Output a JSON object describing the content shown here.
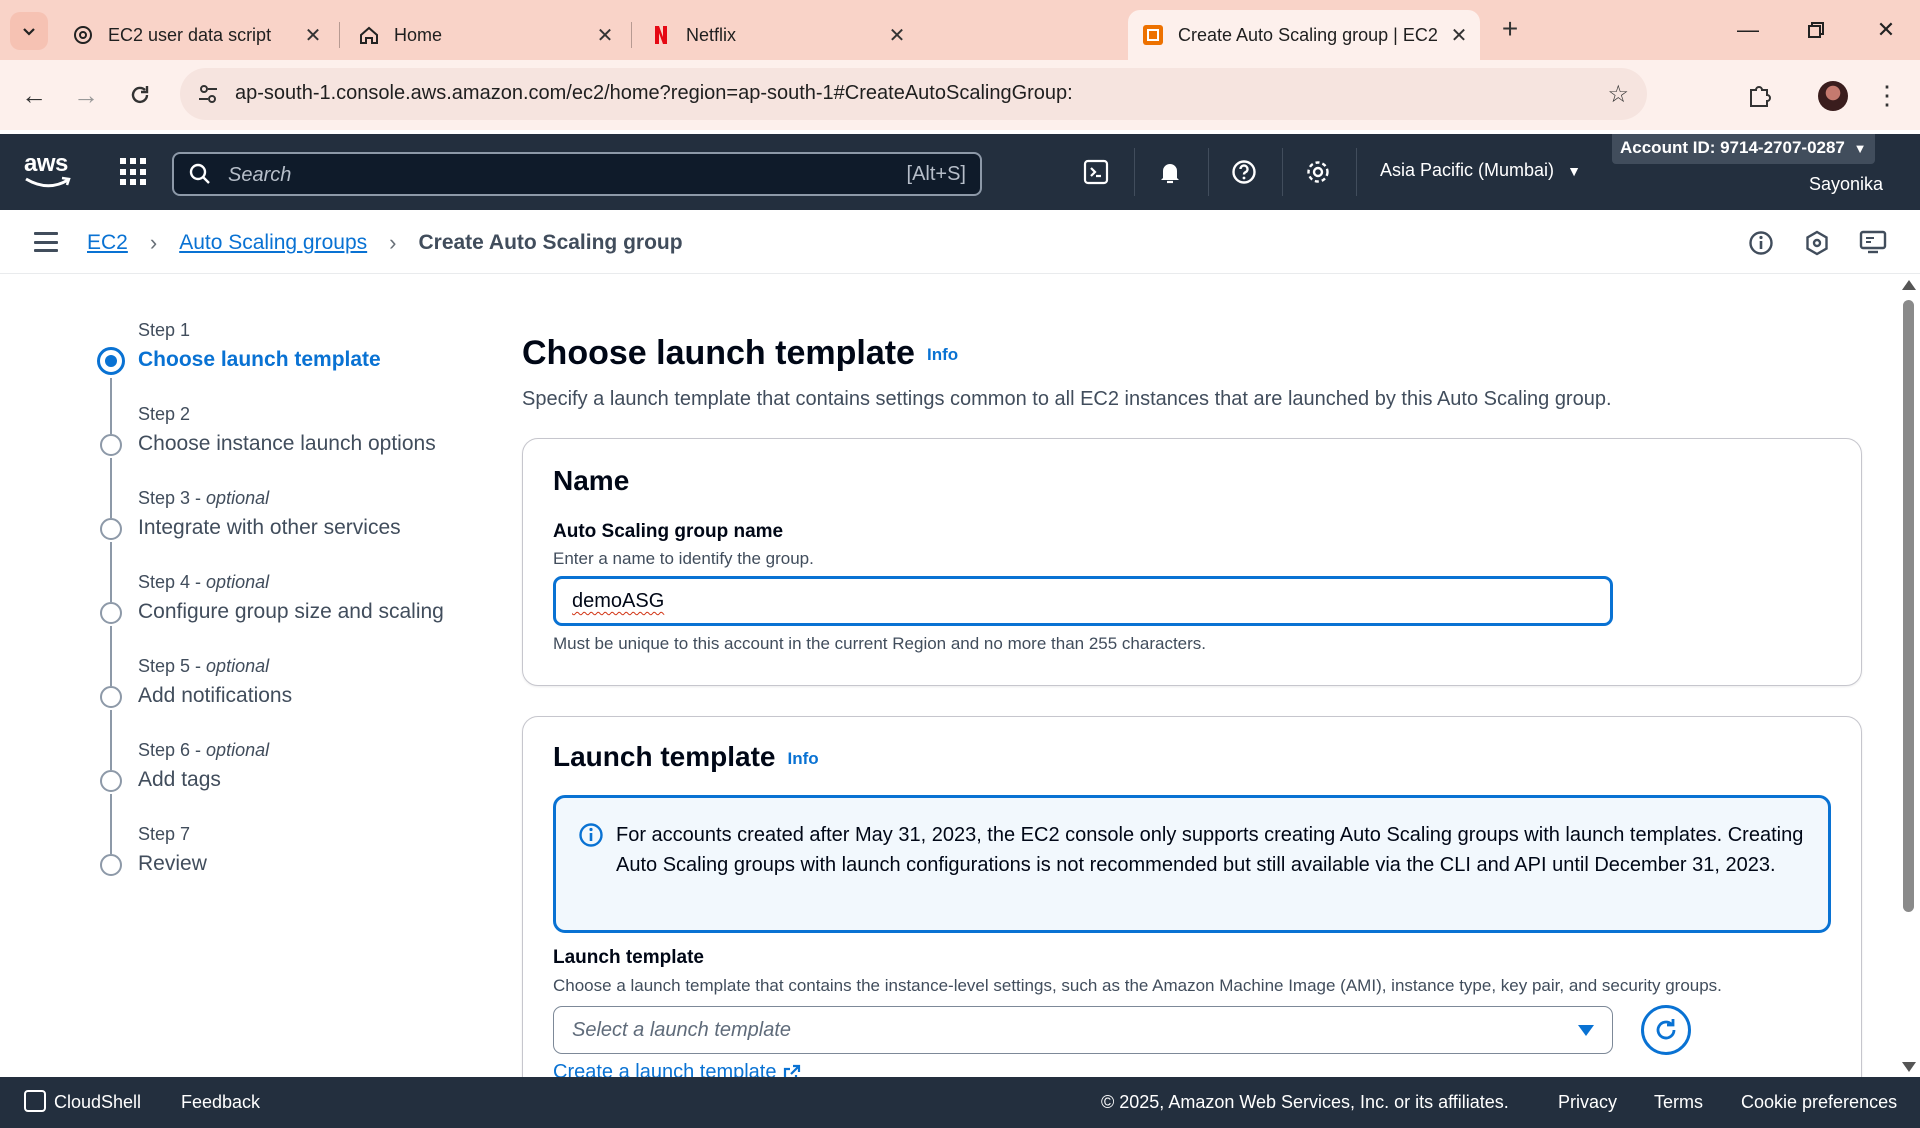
{
  "browser": {
    "tabs": [
      {
        "title": "EC2 user data script",
        "icon": "openai-icon"
      },
      {
        "title": "Home",
        "icon": "home-icon"
      },
      {
        "title": "Netflix",
        "icon": "netflix-icon"
      },
      {
        "title": "Create Auto Scaling group | EC2",
        "icon": "aws-ec2-icon",
        "active": true
      }
    ],
    "url": "ap-south-1.console.aws.amazon.com/ec2/home?region=ap-south-1#CreateAutoScalingGroup:"
  },
  "aws_nav": {
    "logo": "aws",
    "search_placeholder": "Search",
    "search_shortcut": "[Alt+S]",
    "region": "Asia Pacific (Mumbai)",
    "account": "Account ID: 9714-2707-0287",
    "user": "Sayonika"
  },
  "breadcrumb": {
    "items": [
      "EC2",
      "Auto Scaling groups"
    ],
    "current": "Create Auto Scaling group"
  },
  "steps": [
    {
      "num": "Step 1",
      "optional": "",
      "label": "Choose launch template",
      "active": true
    },
    {
      "num": "Step 2",
      "optional": "",
      "label": "Choose instance launch options"
    },
    {
      "num": "Step 3",
      "optional": "optional",
      "label": "Integrate with other services"
    },
    {
      "num": "Step 4",
      "optional": "optional",
      "label": "Configure group size and scaling"
    },
    {
      "num": "Step 5",
      "optional": "optional",
      "label": "Add notifications"
    },
    {
      "num": "Step 6",
      "optional": "optional",
      "label": "Add tags"
    },
    {
      "num": "Step 7",
      "optional": "",
      "label": "Review"
    }
  ],
  "main": {
    "title": "Choose launch template",
    "info": "Info",
    "description": "Specify a launch template that contains settings common to all EC2 instances that are launched by this Auto Scaling group.",
    "name_card": {
      "heading": "Name",
      "label": "Auto Scaling group name",
      "description": "Enter a name to identify the group.",
      "value": "demoASG",
      "constraint": "Must be unique to this account in the current Region and no more than 255 characters."
    },
    "template_card": {
      "heading": "Launch template",
      "info": "Info",
      "alert": "For accounts created after May 31, 2023, the EC2 console only supports creating Auto Scaling groups with launch templates. Creating Auto Scaling groups with launch configurations is not recommended but still available via the CLI and API until December 31, 2023.",
      "label": "Launch template",
      "description": "Choose a launch template that contains the instance-level settings, such as the Amazon Machine Image (AMI), instance type, key pair, and security groups.",
      "select_placeholder": "Select a launch template",
      "create_link": "Create a launch template"
    }
  },
  "footer": {
    "cloudshell": "CloudShell",
    "feedback": "Feedback",
    "copyright": "© 2025, Amazon Web Services, Inc. or its affiliates.",
    "privacy": "Privacy",
    "terms": "Terms",
    "cookies": "Cookie preferences"
  },
  "colors": {
    "link": "#0972d3",
    "nav_bg": "#232f3e",
    "tabbar_bg": "#f9d3c8"
  }
}
